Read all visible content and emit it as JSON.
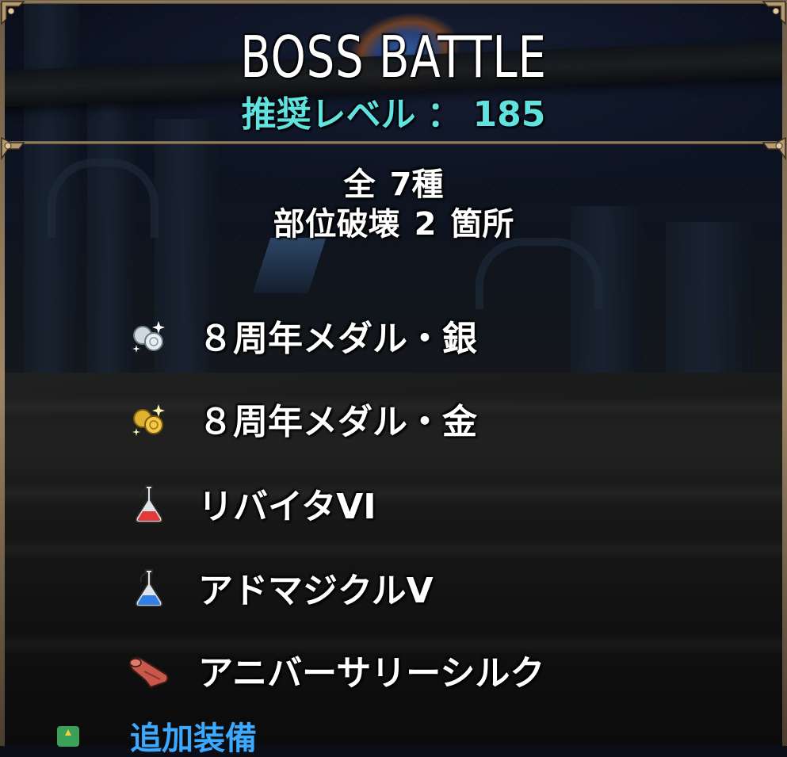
{
  "header": {
    "title": "BOSS BATTLE",
    "level_label": "推奨レベル",
    "level_separator": "：",
    "level_value": "185"
  },
  "summary": {
    "total_prefix": "全",
    "total_count": "7種",
    "break_label": "部位破壊",
    "break_count": "2",
    "break_suffix": "箇所"
  },
  "rewards": [
    {
      "label": "８周年メダル・銀",
      "icon": "silver-medal-icon"
    },
    {
      "label": "８周年メダル・金",
      "icon": "gold-medal-icon"
    },
    {
      "label": "リバイタVI",
      "icon": "red-potion-icon"
    },
    {
      "label": "アドマジクルV",
      "icon": "blue-potion-icon"
    },
    {
      "label": "アニバーサリーシルク",
      "icon": "silk-cloth-icon"
    }
  ],
  "partial_row": {
    "text": "追加装備"
  },
  "colors": {
    "level_text": "#5fe2e0",
    "frame": "#a08866",
    "partial_text": "#3aa9ff"
  }
}
